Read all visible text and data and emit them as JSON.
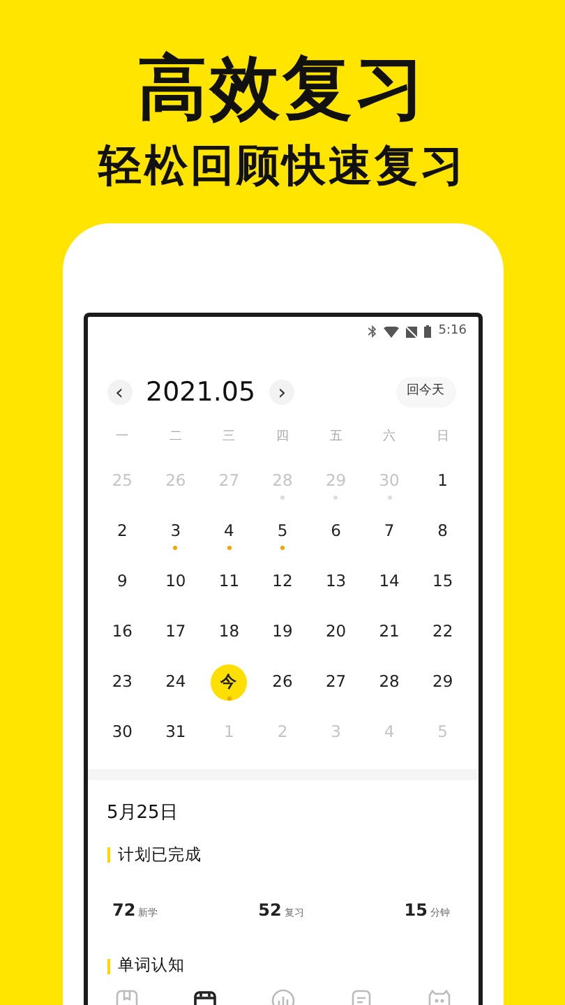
{
  "headline": "高效复习",
  "subheadline": "轻松回顾快速复习",
  "status_bar": {
    "time": "5:16"
  },
  "calendar": {
    "month": "2021.05",
    "prev": "‹",
    "next": "›",
    "today_button": "回今天",
    "weekdays": [
      "一",
      "二",
      "三",
      "四",
      "五",
      "六",
      "日"
    ],
    "days": [
      {
        "label": "25",
        "muted": true,
        "dot": false,
        "selected": false
      },
      {
        "label": "26",
        "muted": true,
        "dot": false,
        "selected": false
      },
      {
        "label": "27",
        "muted": true,
        "dot": false,
        "selected": false
      },
      {
        "label": "28",
        "muted": true,
        "dot": true,
        "selected": false
      },
      {
        "label": "29",
        "muted": true,
        "dot": true,
        "selected": false
      },
      {
        "label": "30",
        "muted": true,
        "dot": true,
        "selected": false
      },
      {
        "label": "1",
        "muted": false,
        "dot": false,
        "selected": false
      },
      {
        "label": "2",
        "muted": false,
        "dot": false,
        "selected": false
      },
      {
        "label": "3",
        "muted": false,
        "dot": true,
        "selected": false
      },
      {
        "label": "4",
        "muted": false,
        "dot": true,
        "selected": false
      },
      {
        "label": "5",
        "muted": false,
        "dot": true,
        "selected": false
      },
      {
        "label": "6",
        "muted": false,
        "dot": false,
        "selected": false
      },
      {
        "label": "7",
        "muted": false,
        "dot": false,
        "selected": false
      },
      {
        "label": "8",
        "muted": false,
        "dot": false,
        "selected": false
      },
      {
        "label": "9",
        "muted": false,
        "dot": false,
        "selected": false
      },
      {
        "label": "10",
        "muted": false,
        "dot": false,
        "selected": false
      },
      {
        "label": "11",
        "muted": false,
        "dot": false,
        "selected": false
      },
      {
        "label": "12",
        "muted": false,
        "dot": false,
        "selected": false
      },
      {
        "label": "13",
        "muted": false,
        "dot": false,
        "selected": false
      },
      {
        "label": "14",
        "muted": false,
        "dot": false,
        "selected": false
      },
      {
        "label": "15",
        "muted": false,
        "dot": false,
        "selected": false
      },
      {
        "label": "16",
        "muted": false,
        "dot": false,
        "selected": false
      },
      {
        "label": "17",
        "muted": false,
        "dot": false,
        "selected": false
      },
      {
        "label": "18",
        "muted": false,
        "dot": false,
        "selected": false
      },
      {
        "label": "19",
        "muted": false,
        "dot": false,
        "selected": false
      },
      {
        "label": "20",
        "muted": false,
        "dot": false,
        "selected": false
      },
      {
        "label": "21",
        "muted": false,
        "dot": false,
        "selected": false
      },
      {
        "label": "22",
        "muted": false,
        "dot": false,
        "selected": false
      },
      {
        "label": "23",
        "muted": false,
        "dot": false,
        "selected": false
      },
      {
        "label": "24",
        "muted": false,
        "dot": false,
        "selected": false
      },
      {
        "label": "今",
        "muted": false,
        "dot": true,
        "selected": true
      },
      {
        "label": "26",
        "muted": false,
        "dot": false,
        "selected": false
      },
      {
        "label": "27",
        "muted": false,
        "dot": false,
        "selected": false
      },
      {
        "label": "28",
        "muted": false,
        "dot": false,
        "selected": false
      },
      {
        "label": "29",
        "muted": false,
        "dot": false,
        "selected": false
      },
      {
        "label": "30",
        "muted": false,
        "dot": false,
        "selected": false
      },
      {
        "label": "31",
        "muted": false,
        "dot": false,
        "selected": false
      },
      {
        "label": "1",
        "muted": true,
        "dot": false,
        "selected": false
      },
      {
        "label": "2",
        "muted": true,
        "dot": false,
        "selected": false
      },
      {
        "label": "3",
        "muted": true,
        "dot": false,
        "selected": false
      },
      {
        "label": "4",
        "muted": true,
        "dot": false,
        "selected": false
      },
      {
        "label": "5",
        "muted": true,
        "dot": false,
        "selected": false
      }
    ]
  },
  "detail": {
    "date": "5月25日",
    "plan_title": "计划已完成",
    "stats": [
      {
        "value": "72",
        "unit": "新学"
      },
      {
        "value": "52",
        "unit": "复习"
      },
      {
        "value": "15",
        "unit": "分钟"
      }
    ],
    "section_title": "单词认知"
  },
  "tab_bar": [
    {
      "kind": "book",
      "selected": false
    },
    {
      "kind": "calendar",
      "selected": true
    },
    {
      "kind": "chart",
      "selected": false
    },
    {
      "kind": "note",
      "selected": false
    },
    {
      "kind": "face",
      "selected": false
    }
  ]
}
